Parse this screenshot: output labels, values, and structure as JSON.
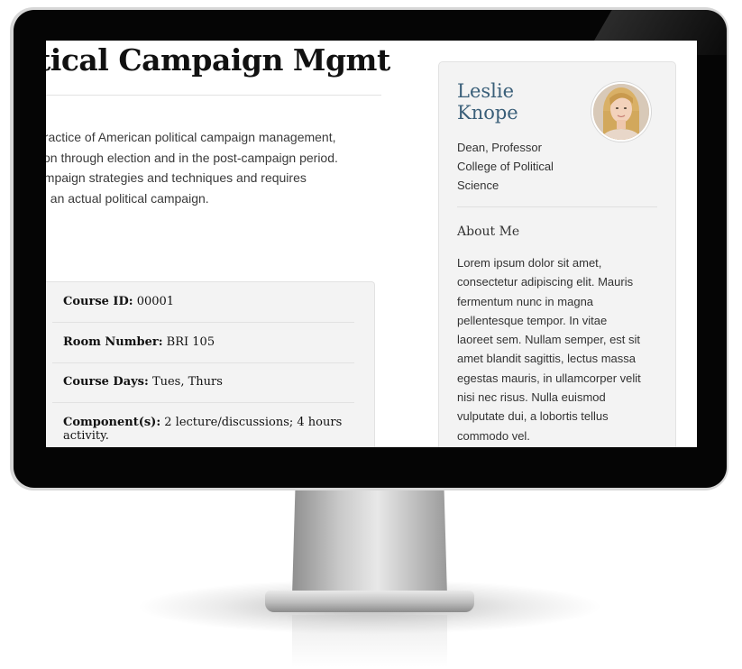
{
  "course": {
    "title": "itical Campaign Mgmt",
    "description_lines": [
      "practice of American political campaign management,",
      "tion through election and in the post-campaign period.",
      "ampaign strategies and techniques and requires",
      "in an actual political campaign."
    ],
    "details": [
      {
        "label": "Course ID:",
        "value": " 00001"
      },
      {
        "label": "Room Number:",
        "value": " BRI 105"
      },
      {
        "label": "Course Days:",
        "value": " Tues, Thurs"
      },
      {
        "label": "Component(s):",
        "value": " 2 lecture/discussions; 4 hours",
        "value_line2": "activity."
      }
    ]
  },
  "instructor": {
    "first_name": "Leslie",
    "last_name": "Knope",
    "role_lines": [
      "Dean, Professor",
      "College of Political",
      "Science"
    ],
    "avatar_icon": "instructor-photo",
    "about_heading": "About Me",
    "about_lines": [
      "Lorem ipsum dolor sit amet,",
      "consectetur adipiscing elit. Mauris",
      "fermentum nunc in magna",
      "pellentesque tempor. In vitae",
      "laoreet sem. Nullam semper, est sit",
      "amet blandit sagittis, lectus massa",
      "egestas mauris, in ullamcorper velit",
      "nisi nec risus. Nulla euismod",
      "vulputate dui, a lobortis tellus",
      "commodo vel."
    ]
  },
  "colors": {
    "name_accent": "#3a5f79",
    "panel_bg": "#f3f3f3",
    "bezel": "#050505"
  }
}
